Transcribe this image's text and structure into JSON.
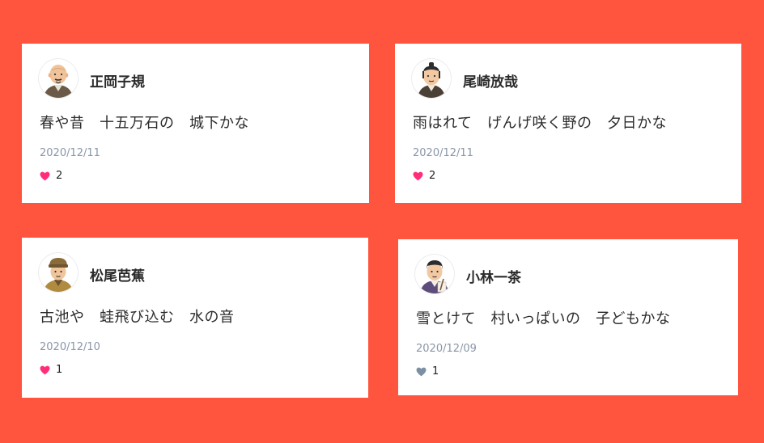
{
  "posts": [
    {
      "author": "正岡子規",
      "avatar_icon": "bald-man-avatar-icon",
      "text": "春や昔　十五万石の　城下かな",
      "date": "2020/12/11",
      "likes": "2",
      "liked": true
    },
    {
      "author": "尾崎放哉",
      "avatar_icon": "man-with-topknot-avatar-icon",
      "text": "雨はれて　げんげ咲く野の　夕日かな",
      "date": "2020/12/11",
      "likes": "2",
      "liked": true
    },
    {
      "author": "松尾芭蕉",
      "avatar_icon": "man-with-hat-avatar-icon",
      "text": "古池や　蛙飛び込む　水の音",
      "date": "2020/12/10",
      "likes": "1",
      "liked": true
    },
    {
      "author": "小林一茶",
      "avatar_icon": "man-with-brush-avatar-icon",
      "text": "雪とけて　村いっぱいの　子どもかな",
      "date": "2020/12/09",
      "likes": "1",
      "liked": false
    }
  ],
  "colors": {
    "background": "#ff543e",
    "card": "#ffffff",
    "heart_liked": "#ff2d7a",
    "heart_unliked": "#7d8fa3",
    "date": "#8a96a8"
  }
}
